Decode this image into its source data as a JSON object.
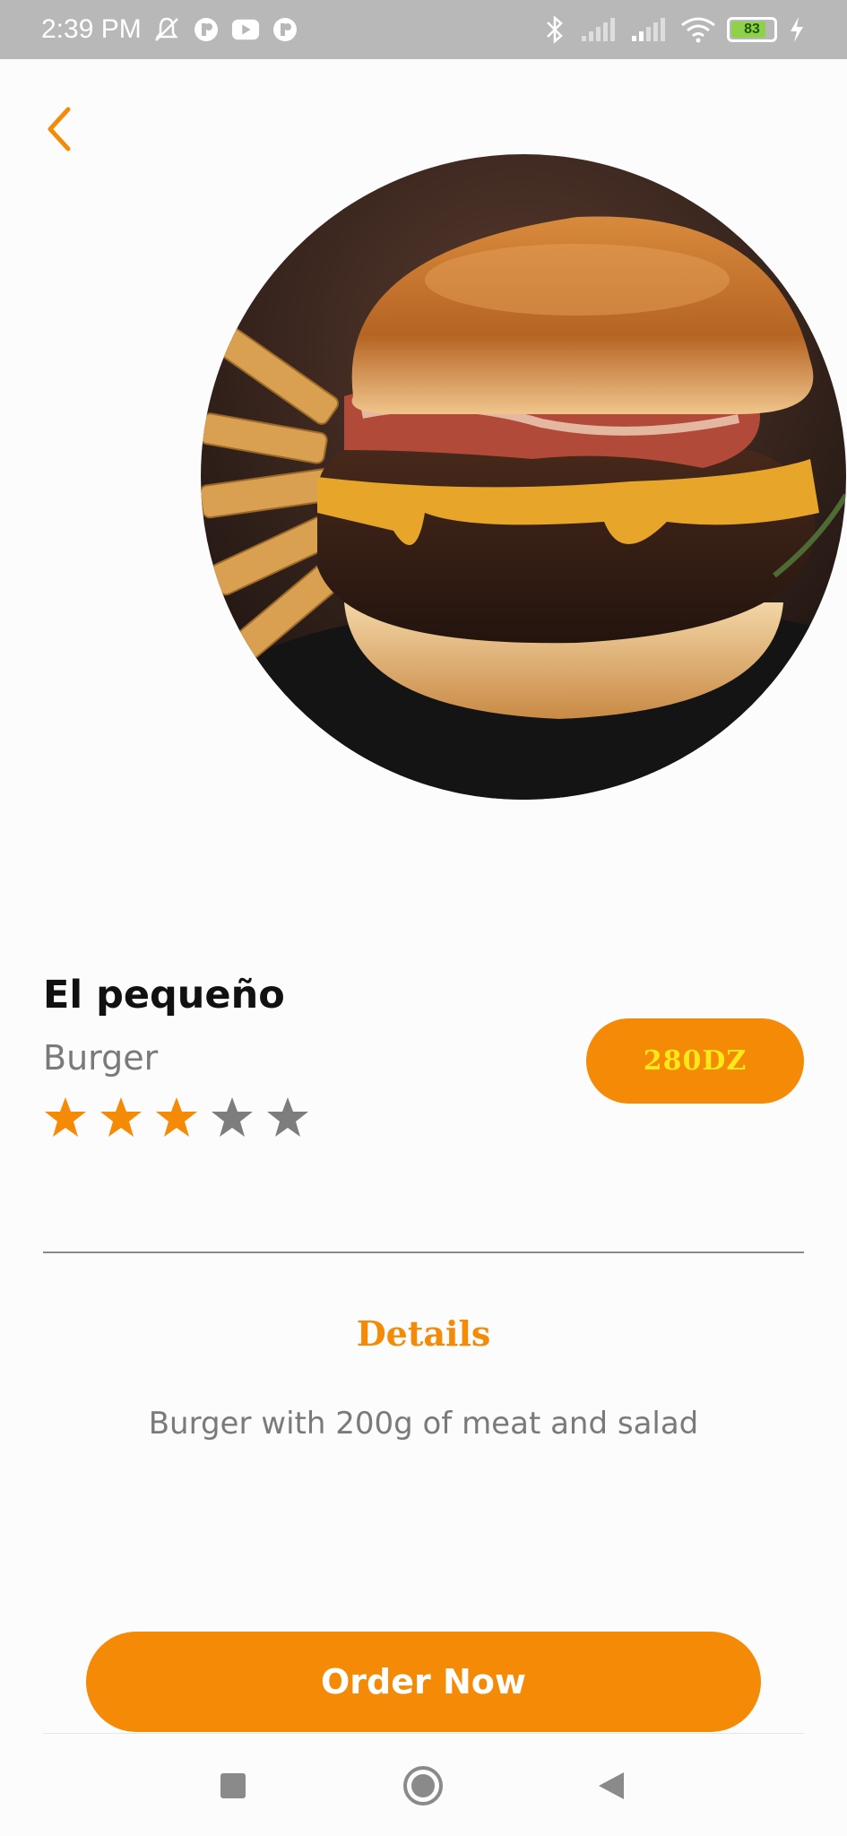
{
  "status_bar": {
    "time": "2:39 PM",
    "battery_level": "83",
    "battery_fraction": 0.83
  },
  "product": {
    "name": "El pequeño",
    "category": "Burger",
    "price": "280DZ",
    "rating": 3,
    "rating_max": 5
  },
  "details": {
    "title": "Details",
    "description": "Burger with 200g of meat and salad"
  },
  "actions": {
    "order_label": "Order Now"
  },
  "colors": {
    "accent": "#f58a07",
    "price_text": "#ffe81a",
    "star_active": "#f58a07",
    "star_inactive": "#7d7d7d"
  },
  "icons": {
    "back": "chevron-left-icon",
    "nav_recent": "square-icon",
    "nav_home": "circle-icon",
    "nav_back": "triangle-left-icon"
  }
}
